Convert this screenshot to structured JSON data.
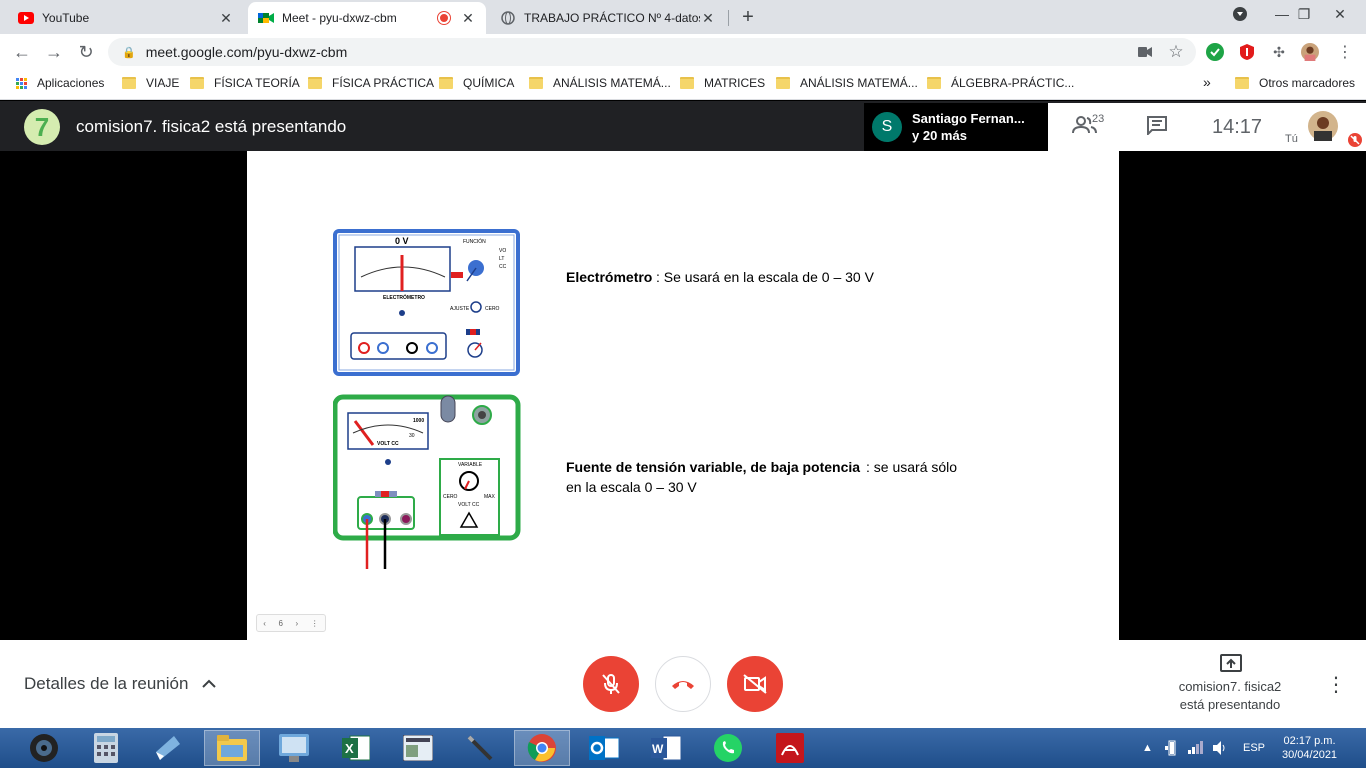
{
  "browser": {
    "tabs": [
      {
        "label": "YouTube",
        "active": false
      },
      {
        "label": "Meet - pyu-dxwz-cbm",
        "active": true
      },
      {
        "label": "TRABAJO PRÁCTICO Nº 4-datos",
        "active": false
      }
    ],
    "url": "meet.google.com/pyu-dxwz-cbm",
    "bookmarks": [
      "Aplicaciones",
      "VIAJE",
      "FÍSICA TEORÍA",
      "FÍSICA PRÁCTICA",
      "QUÍMICA",
      "ANÁLISIS MATEMÁ...",
      "MATRICES",
      "ANÁLISIS MATEMÁ...",
      "ÁLGEBRA-PRÁCTIC...",
      "Otros marcadores"
    ],
    "bookmarks_overflow": "»"
  },
  "meet": {
    "presenter_title": "comision7. fisica2 está presentando",
    "logo_char": "7",
    "participants_avatar": "S",
    "participants_line1": "Santiago Fernan...",
    "participants_line2": "y 20 más",
    "people_count": "23",
    "time": "14:17",
    "self_label": "Tú",
    "details_label": "Detalles de la reunión",
    "presenting_line1": "comision7. fisica2",
    "presenting_line2": "está presentando"
  },
  "slide": {
    "electrometer_header": "0 V",
    "electrometer_brand": "ELECTRÓMETRO",
    "electrometer_funcion": "FUNCIÓN",
    "electrometer_ajuste": "AJUSTE",
    "electrometer_cero": "CERO",
    "electrometer_volt": "VOLT CC",
    "electrometer_label": "Electrómetro",
    "electrometer_desc": ":  Se usará en la escala de  0 – 30 V",
    "source_meter_scale": "1000",
    "source_meter_30": "30",
    "source_meter_unit": "VOLT CC",
    "source_variable": "VARIABLE",
    "source_cero": "CERO",
    "source_max": "MAX",
    "source_volt": "VOLT CC",
    "source_label": "Fuente de tensión variable, de baja potencia",
    "source_desc1": ": se usará sólo",
    "source_desc2": " en la escala  0 – 30 V",
    "page_number": "6"
  },
  "system": {
    "language": "ESP",
    "time": "02:17 p.m.",
    "date": "30/04/2021"
  },
  "colors": {
    "meet_dark": "#202124",
    "danger_red": "#ea4335",
    "electrometer_blue": "#3b6fd0",
    "source_green": "#2eab48"
  }
}
